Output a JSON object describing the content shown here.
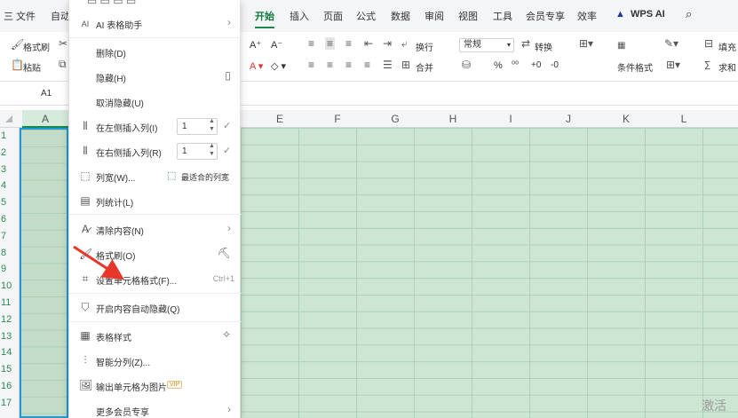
{
  "menubar": {
    "items": [
      {
        "label": "三 文件"
      },
      {
        "label": "自动"
      },
      {
        "label": "开始"
      },
      {
        "label": "插入"
      },
      {
        "label": "页面"
      },
      {
        "label": "公式"
      },
      {
        "label": "数据"
      },
      {
        "label": "审阅"
      },
      {
        "label": "视图"
      },
      {
        "label": "工具"
      },
      {
        "label": "会员专享"
      },
      {
        "label": "效率"
      },
      {
        "label": "WPS AI"
      }
    ],
    "active": "开始"
  },
  "ribbon": {
    "format_painter": "格式刷",
    "paste": "粘贴",
    "font_grow": "A⁺",
    "font_shrink": "A⁻",
    "wrap": "换行",
    "merge": "合并",
    "number_format": "常规",
    "convert": "转换",
    "conditional_format": "条件格式",
    "fill": "填充",
    "sum": "求和",
    "percent": "%"
  },
  "formula_bar": {
    "name_box": "A1"
  },
  "columns": [
    "A",
    "E",
    "F",
    "G",
    "H",
    "I",
    "J",
    "K",
    "L"
  ],
  "rows": [
    "1",
    "2",
    "3",
    "4",
    "5",
    "6",
    "7",
    "8",
    "9",
    "10",
    "11",
    "12",
    "13",
    "14",
    "15",
    "16",
    "17"
  ],
  "context_menu": {
    "items": [
      {
        "label": "AI 表格助手",
        "icon": "ai-icon",
        "arrow": "›"
      },
      {
        "label": "删除(D)"
      },
      {
        "label": "隐藏(H)",
        "right_icon": "book-icon"
      },
      {
        "label": "取消隐藏(U)"
      },
      {
        "label": "在左侧插入列(I)",
        "icon": "insert-left-icon",
        "value": "1"
      },
      {
        "label": "在右侧插入列(R)",
        "icon": "insert-right-icon",
        "value": "1"
      },
      {
        "label": "列宽(W)...",
        "icon": "column-width-icon",
        "side": "最适合的列宽"
      },
      {
        "label": "列统计(L)",
        "icon": "column-stats-icon"
      },
      {
        "label": "清除内容(N)",
        "icon": "clear-icon",
        "arrow": "›"
      },
      {
        "label": "格式刷(O)",
        "icon": "format-painter-icon",
        "right_icon": "brush-icon"
      },
      {
        "label": "设置单元格格式(F)...",
        "icon": "cell-format-icon",
        "hint": "Ctrl+1"
      },
      {
        "label": "开启内容自动隐藏(Q)",
        "icon": "shield-icon"
      },
      {
        "label": "表格样式",
        "icon": "table-style-icon",
        "right_icon": "magic-wand-icon"
      },
      {
        "label": "智能分列(Z)...",
        "icon": "smart-split-icon"
      },
      {
        "label": "输出单元格为图片",
        "icon": "image-icon",
        "badge": "VIP"
      },
      {
        "label": "更多会员专享",
        "arrow": "›"
      }
    ]
  },
  "watermark": "激活",
  "colors": {
    "accent": "#1a8a4a",
    "grid": "#cce6d2",
    "selection": "#1f9ad6",
    "arrow": "#e8362a"
  }
}
